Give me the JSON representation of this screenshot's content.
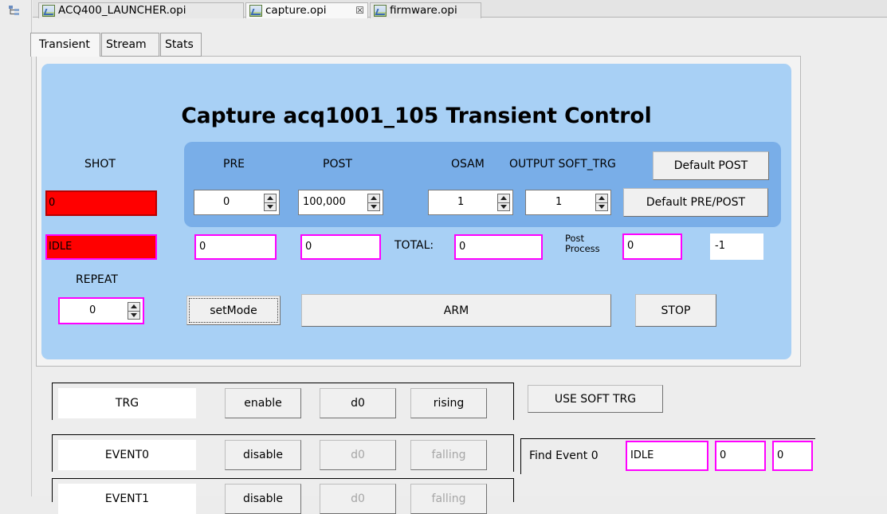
{
  "editor_tabs": [
    {
      "label": "ACQ400_LAUNCHER.opi"
    },
    {
      "label": "capture.opi"
    },
    {
      "label": "firmware.opi"
    }
  ],
  "close_glyph": "☒",
  "inner_tabs": [
    {
      "label": "Transient"
    },
    {
      "label": "Stream"
    },
    {
      "label": "Stats"
    }
  ],
  "title": "Capture acq1001_105 Transient  Control",
  "labels": {
    "shot": "SHOT",
    "pre": "PRE",
    "post": "POST",
    "osam": "OSAM",
    "output_soft_trg": "OUTPUT SOFT_TRG",
    "repeat": "REPEAT",
    "total": "TOTAL:",
    "post_process_line1": "Post",
    "post_process_line2": "Process"
  },
  "shot_value": "0",
  "state_value": "IDLE",
  "spinners": {
    "pre": "0",
    "post": "100,000",
    "osam": "1",
    "output_soft_trg": "1",
    "repeat": "0"
  },
  "readouts": {
    "pre": "0",
    "post": "0",
    "total": "0",
    "post_process": "0",
    "extra": "-1"
  },
  "buttons": {
    "default_post": "Default POST",
    "default_pre_post": "Default PRE/POST",
    "set_mode": "setMode",
    "arm": "ARM",
    "stop": "STOP",
    "use_soft_trg": "USE SOFT TRG"
  },
  "trigger_rows": [
    {
      "name": "TRG",
      "mode": "enable",
      "signal": "d0",
      "edge": "rising",
      "disabled": false
    },
    {
      "name": "EVENT0",
      "mode": "disable",
      "signal": "d0",
      "edge": "falling",
      "disabled": true
    },
    {
      "name": "EVENT1",
      "mode": "disable",
      "signal": "d0",
      "edge": "falling",
      "disabled": true
    }
  ],
  "find_event": {
    "label": "Find Event 0",
    "state": "IDLE",
    "value1": "0",
    "value2": "0"
  }
}
